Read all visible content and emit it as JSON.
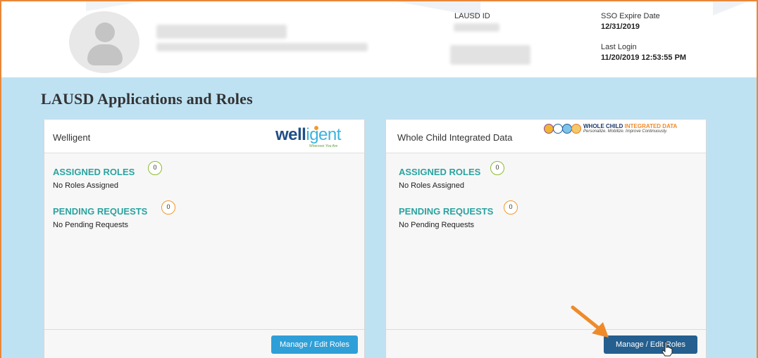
{
  "header": {
    "lausd_id_label": "LAUSD ID",
    "sso_expire_label": "SSO Expire Date",
    "sso_expire_value": "12/31/2019",
    "last_login_label": "Last Login",
    "last_login_value": "11/20/2019 12:53:55 PM"
  },
  "page": {
    "title": "LAUSD Applications and Roles"
  },
  "cards": [
    {
      "title": "Welligent",
      "logo": {
        "word_bold": "well",
        "word_light": "igent",
        "tagline": "Wherever You Are"
      },
      "assigned_roles_label": "ASSIGNED ROLES",
      "assigned_roles_count": "0",
      "assigned_roles_text": "No Roles Assigned",
      "pending_requests_label": "PENDING REQUESTS",
      "pending_requests_count": "0",
      "pending_requests_text": "No Pending Requests",
      "button_label": "Manage / Edit Roles"
    },
    {
      "title": "Whole Child Integrated Data",
      "logo": {
        "line1_a": "WHOLE CHILD ",
        "line1_b": "INTEGRATED DATA",
        "line2": "Personalize. Mobilize. Improve Continuously."
      },
      "assigned_roles_label": "ASSIGNED ROLES",
      "assigned_roles_count": "0",
      "assigned_roles_text": "No Roles Assigned",
      "pending_requests_label": "PENDING REQUESTS",
      "pending_requests_count": "0",
      "pending_requests_text": "No Pending Requests",
      "button_label": "Manage / Edit Roles"
    }
  ],
  "colors": {
    "accent_teal": "#2aa3a0",
    "button_blue": "#2f9fd8",
    "button_dark": "#245f8f",
    "annotation_orange": "#ef8a2b",
    "background_blue": "#bfe2f3"
  },
  "icons": {
    "avatar": "user-avatar-icon",
    "annotation": "arrow-icon",
    "pointer": "hand-cursor-icon"
  }
}
